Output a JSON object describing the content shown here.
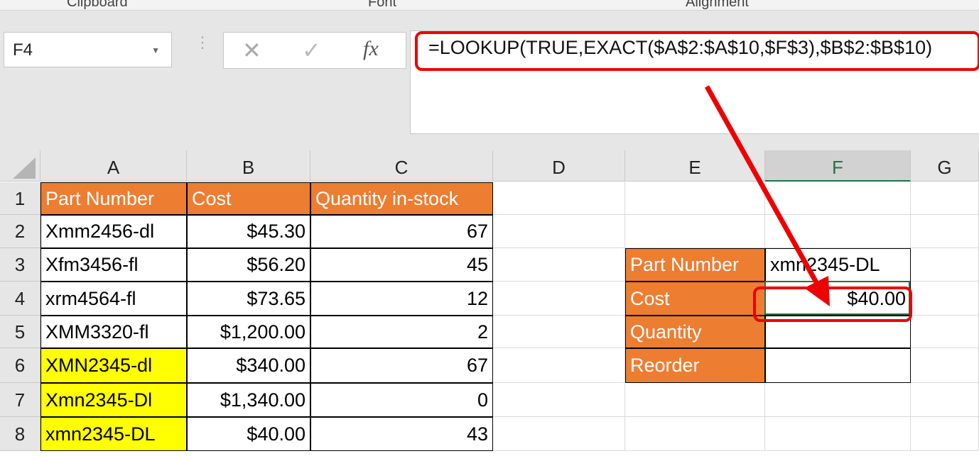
{
  "ribbon": {
    "groups": [
      "Clipboard",
      "Font",
      "Alignment"
    ]
  },
  "name_box": {
    "value": "F4"
  },
  "formula_bar": {
    "cancel_icon": "x-icon",
    "enter_icon": "check-icon",
    "fx_label": "fx",
    "formula": "=LOOKUP(TRUE,EXACT($A$2:$A$10,$F$3),$B$2:$B$10)"
  },
  "columns": [
    "A",
    "B",
    "C",
    "D",
    "E",
    "F",
    "G"
  ],
  "rows": [
    "1",
    "2",
    "3",
    "4",
    "5",
    "6",
    "7",
    "8"
  ],
  "table": {
    "headers": [
      "Part Number",
      "Cost",
      "Quantity in-stock"
    ],
    "rows": [
      [
        "Xmm2456-dl",
        "$45.30",
        "67"
      ],
      [
        "Xfm3456-fl",
        "$56.20",
        "45"
      ],
      [
        "xrm4564-fl",
        "$73.65",
        "12"
      ],
      [
        "XMM3320-fl",
        "$1,200.00",
        "2"
      ],
      [
        "XMN2345-dl",
        "$340.00",
        "67"
      ],
      [
        "Xmn2345-Dl",
        "$1,340.00",
        "0"
      ],
      [
        "xmn2345-DL",
        "$40.00",
        "43"
      ]
    ]
  },
  "lookup": {
    "labels": [
      "Part Number",
      "Cost",
      "Quantity",
      "Reorder"
    ],
    "values": [
      "xmn2345-DL",
      "$40.00",
      "",
      ""
    ]
  },
  "colors": {
    "header_fill": "#ed7d31",
    "highlight": "#ffff00",
    "annotation": "#e00000",
    "selection": "#217346"
  }
}
